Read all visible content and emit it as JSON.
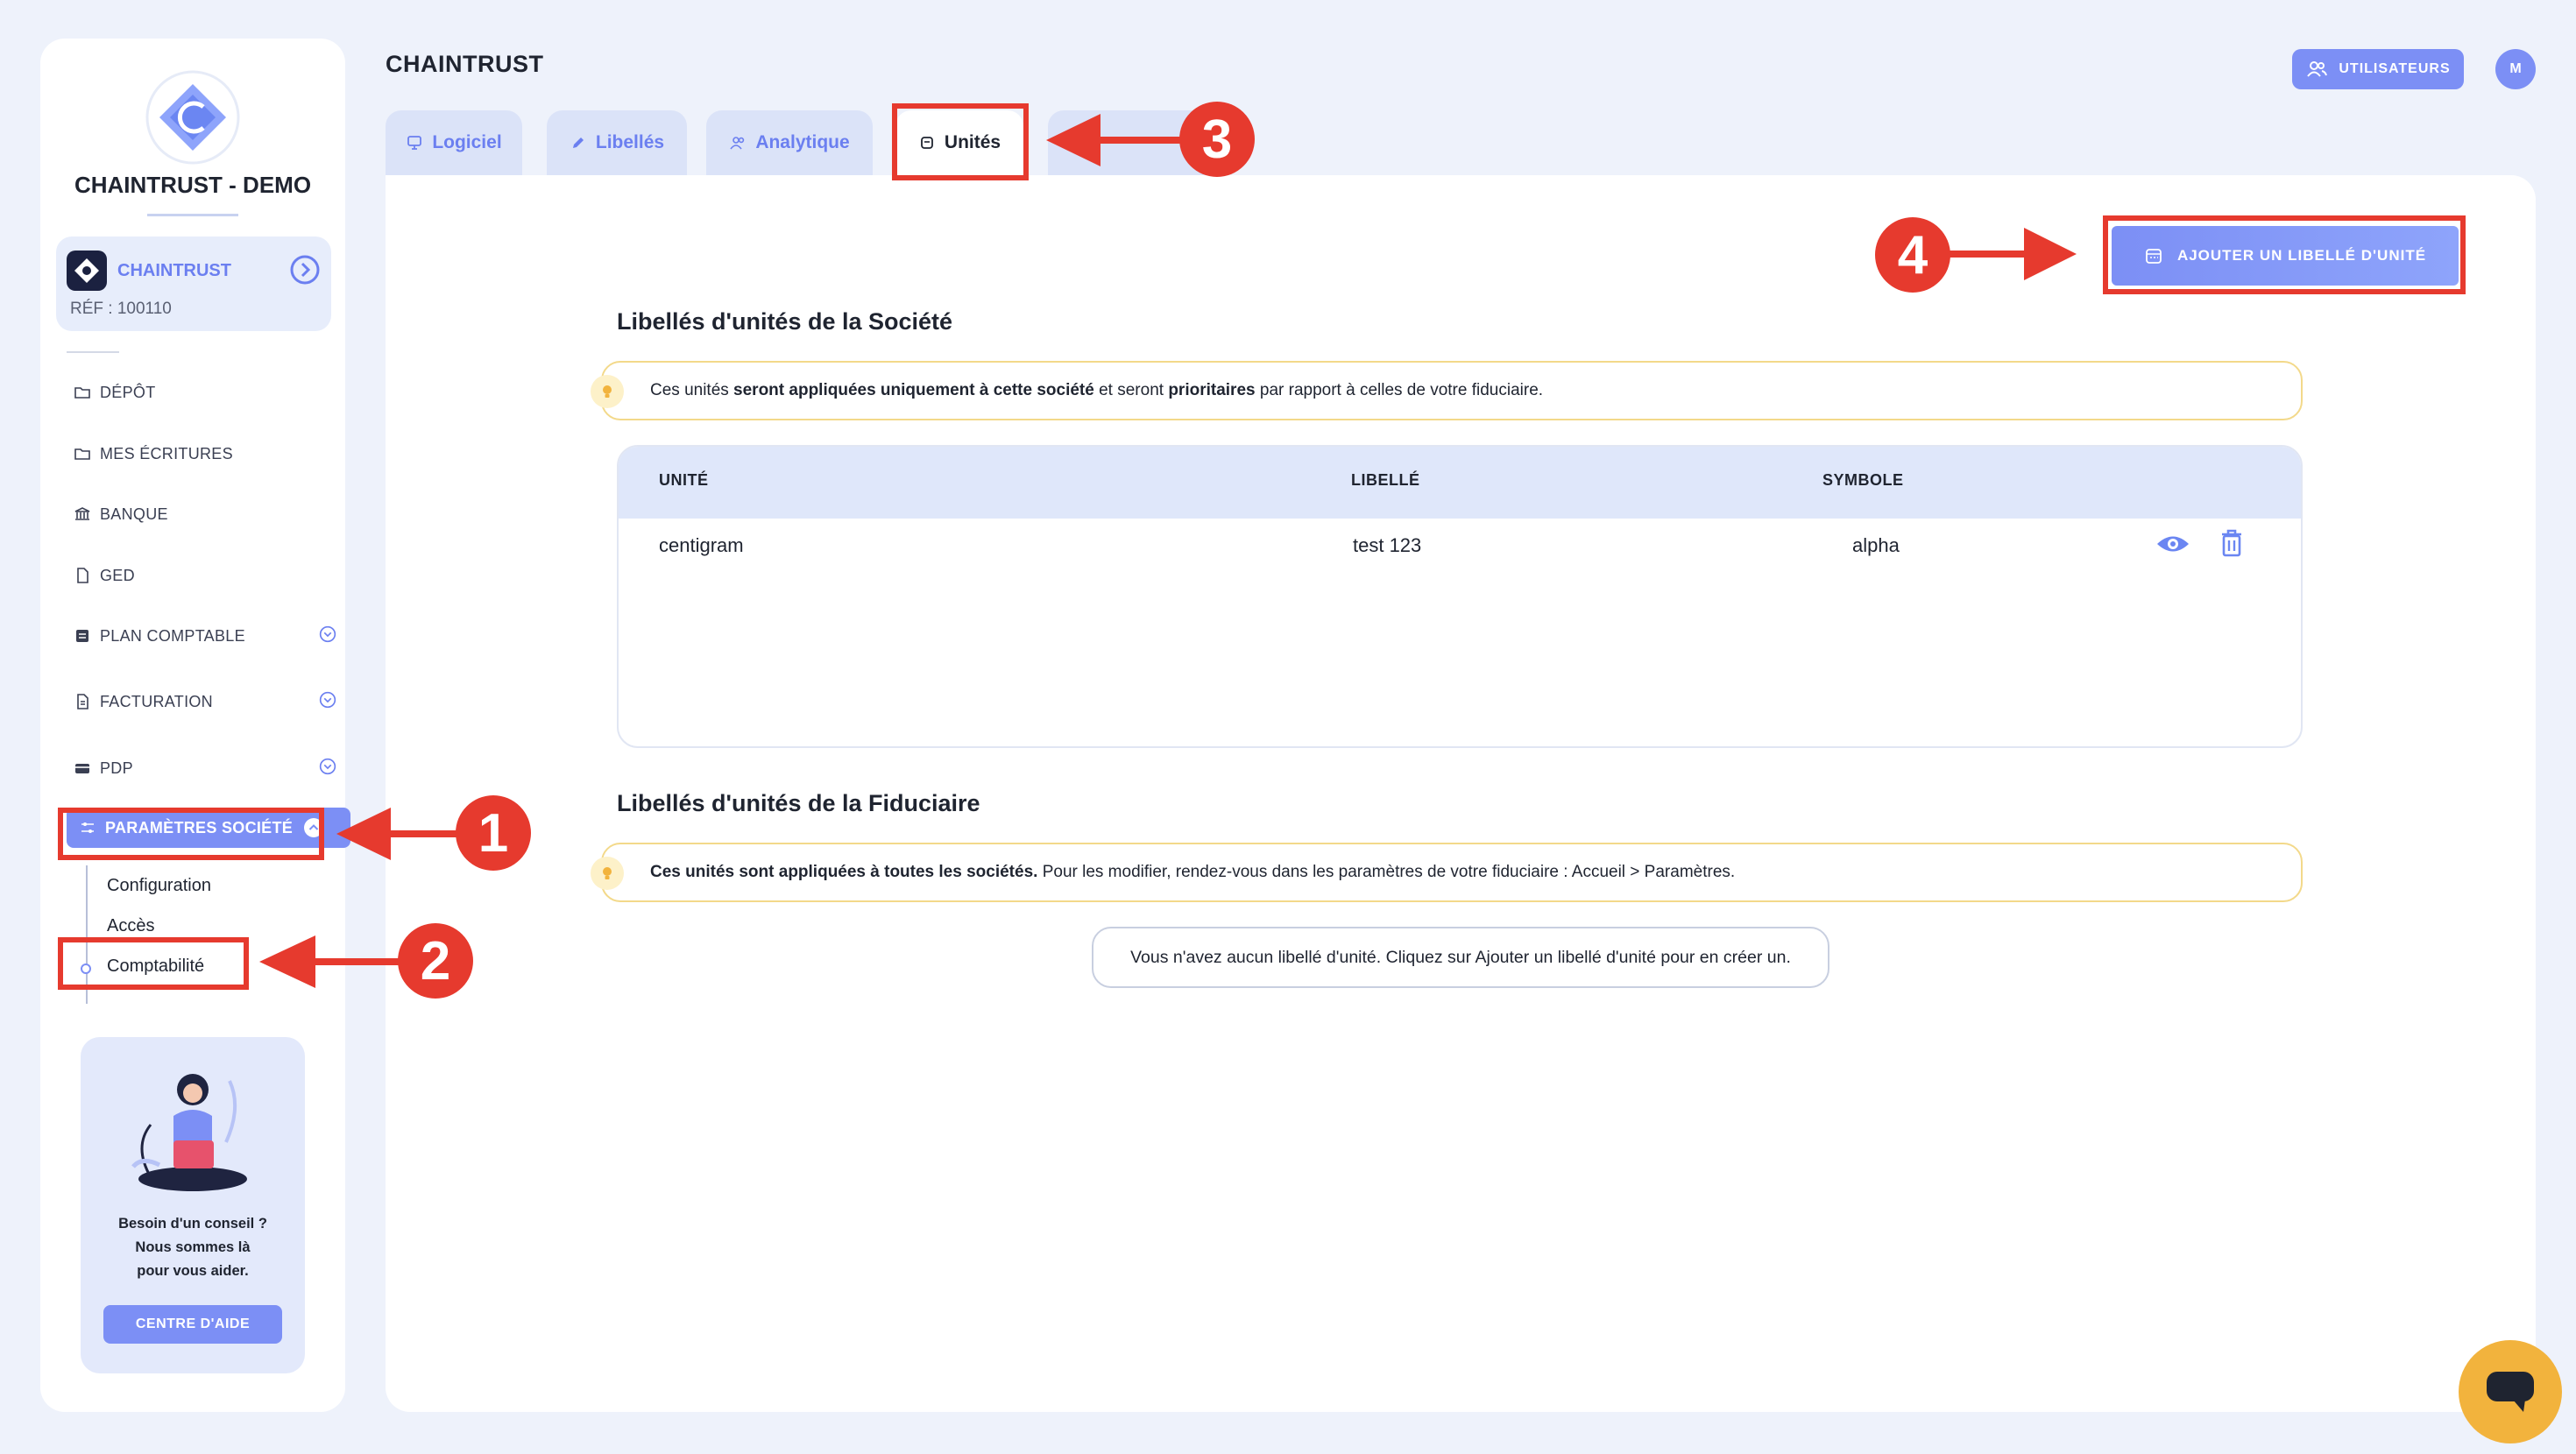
{
  "sidebar": {
    "company_name": "CHAINTRUST - DEMO",
    "card": {
      "name": "CHAINTRUST",
      "ref": "RÉF : 100110"
    },
    "nav": [
      {
        "label": "DÉPÔT",
        "icon": "folder-icon"
      },
      {
        "label": "MES ÉCRITURES",
        "icon": "folder-icon"
      },
      {
        "label": "BANQUE",
        "icon": "bank-icon"
      },
      {
        "label": "GED",
        "icon": "document-icon"
      },
      {
        "label": "PLAN COMPTABLE",
        "icon": "ledger-icon",
        "expandable": true
      },
      {
        "label": "FACTURATION",
        "icon": "invoice-icon",
        "expandable": true
      },
      {
        "label": "PDP",
        "icon": "card-icon",
        "expandable": true
      }
    ],
    "active": {
      "label": "PARAMÈTRES SOCIÉTÉ",
      "icon": "sliders-icon"
    },
    "sub_items": [
      "Configuration",
      "Accès",
      "Comptabilité"
    ],
    "help": {
      "line1": "Besoin d'un conseil ?",
      "line2": "Nous sommes là",
      "line3": "pour vous aider.",
      "button": "CENTRE D'AIDE"
    }
  },
  "header": {
    "title": "CHAINTRUST",
    "users_button": "UTILISATEURS",
    "avatar": "M"
  },
  "tabs": [
    {
      "label": "Logiciel",
      "icon": "monitor-icon"
    },
    {
      "label": "Libellés",
      "icon": "pen-icon"
    },
    {
      "label": "Analytique",
      "icon": "users-icon"
    },
    {
      "label": "Unités",
      "icon": "unit-icon",
      "active": true
    }
  ],
  "main": {
    "add_button": "AJOUTER UN LIBELLÉ D'UNITÉ",
    "company_section": {
      "title": "Libellés d'unités de la Société",
      "info_pre": "Ces unités ",
      "info_b1": "seront appliquées uniquement à cette société",
      "info_mid": " et seront ",
      "info_b2": "prioritaires",
      "info_post": " par rapport à celles de votre fiduciaire.",
      "table": {
        "headers": [
          "UNITÉ",
          "LIBELLÉ",
          "SYMBOLE"
        ],
        "rows": [
          {
            "unite": "centigram",
            "libelle": "test 123",
            "symbole": "alpha"
          }
        ]
      }
    },
    "fiduciary_section": {
      "title": "Libellés d'unités de la Fiduciaire",
      "info_bold": "Ces unités sont appliquées à toutes les sociétés.",
      "info_rest": " Pour les modifier, rendez-vous dans les paramètres de votre fiduciaire : Accueil > Paramètres.",
      "empty_message": "Vous n'avez aucun libellé d'unité. Cliquez sur Ajouter un libellé d'unité pour en créer un."
    }
  },
  "annotations": [
    "1",
    "2",
    "3",
    "4"
  ],
  "colors": {
    "accent": "#7c8ff5",
    "annotation": "#e63a2e",
    "background": "#eef2fb",
    "chat": "#f2b33d"
  }
}
